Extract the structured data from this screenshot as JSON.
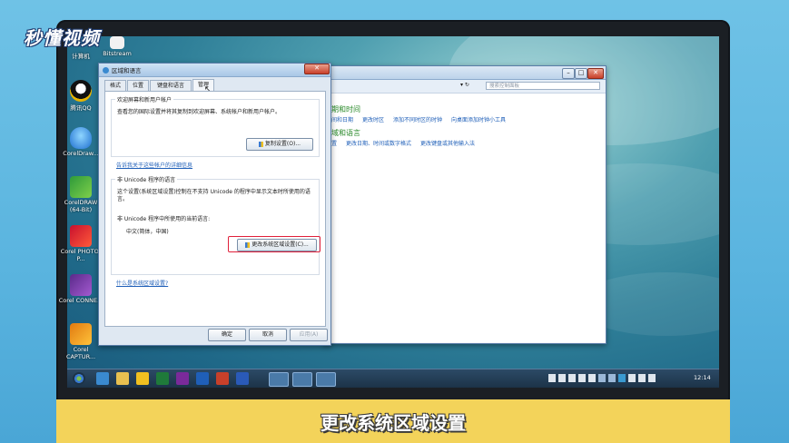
{
  "logo": {
    "text": "秒懂视频"
  },
  "desktop_icons": [
    {
      "label": "计算机"
    },
    {
      "label": "Bitstream"
    },
    {
      "label": "腾讯QQ"
    },
    {
      "label": "CorelDraw..."
    },
    {
      "label": "CorelDRAW (64-Bit)"
    },
    {
      "label": "Corel PHOTO-P..."
    },
    {
      "label": "Corel CONNE..."
    },
    {
      "label": "Corel CAPTUR..."
    }
  ],
  "region_dialog": {
    "title": "区域和语言",
    "tabs": [
      "格式",
      "位置",
      "键盘和语言",
      "管理"
    ],
    "active_tab": "管理",
    "welcome_group": {
      "heading": "欢迎屏幕和新用户帐户",
      "description": "查看您的国际设置并将其复制到欢迎屏幕、系统帐户和新用户帐户。",
      "copy_button": "复制设置(O)..."
    },
    "welcome_link": "告诉我关于这些帐户的详细信息",
    "unicode_group": {
      "heading": "非 Unicode 程序的语言",
      "description": "这个设置(系统区域设置)控制在不支持 Unicode 的程序中显示文本时所使用的语言。",
      "current_label": "非 Unicode 程序中所使用的当前语言:",
      "current_value": "中文(简体，中国)",
      "change_button": "更改系统区域设置(C)..."
    },
    "unicode_link": "什么是系统区域设置?",
    "footer": {
      "ok": "确定",
      "cancel": "取消",
      "apply": "应用(A)"
    }
  },
  "control_panel": {
    "search_placeholder": "搜索控制面板",
    "section1": {
      "heading": "期和时间",
      "links": [
        "间和日期",
        "更改时区",
        "添加不同时区的时钟",
        "向桌面添加时钟小工具"
      ]
    },
    "section2": {
      "heading": "域和语言",
      "links": [
        "置",
        "更改日期、时间或数字格式",
        "更改键盘或其他输入法"
      ]
    }
  },
  "taskbar": {
    "clock": "12:14"
  },
  "caption": {
    "text": "更改系统区域设置"
  },
  "colors": {
    "caption_bg": "#f3d35a",
    "highlight_red": "#e0203a",
    "link_blue": "#1f5fb8",
    "heading_green": "#2a8a2a"
  }
}
